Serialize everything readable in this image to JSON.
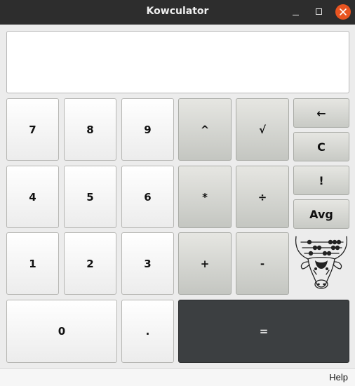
{
  "window": {
    "title": "Kowculator"
  },
  "display": {
    "value": ""
  },
  "keys": {
    "k7": "7",
    "k8": "8",
    "k9": "9",
    "k4": "4",
    "k5": "5",
    "k6": "6",
    "k1": "1",
    "k2": "2",
    "k3": "3",
    "k0": "0",
    "dot": ".",
    "power": "^",
    "sqrt": "√",
    "multiply": "*",
    "divide": "÷",
    "plus": "+",
    "minus": "-",
    "equals": "=",
    "backspace": "←",
    "clear": "C",
    "factorial": "!",
    "average": "Avg"
  },
  "logo": {
    "icon": "cow-abacus-logo-icon"
  },
  "menu": {
    "help": "Help"
  },
  "colors": {
    "close_button": "#e95420",
    "equals_button": "#3c3f41",
    "titlebar": "#2d2d2d"
  }
}
